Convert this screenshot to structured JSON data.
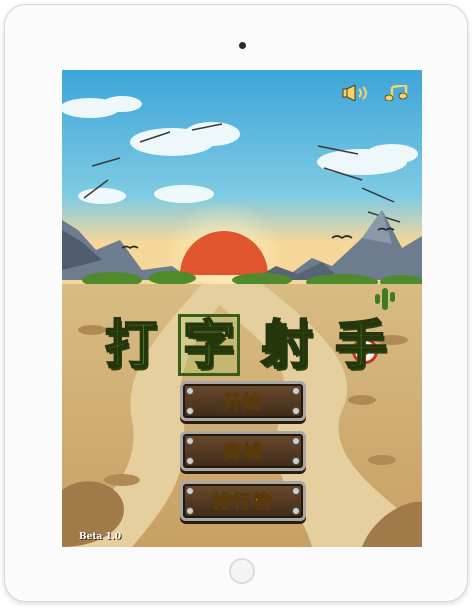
{
  "game": {
    "title_chars": [
      "打",
      "字",
      "射",
      "手"
    ],
    "menu": {
      "start_label": "开始",
      "shop_label": "商城",
      "leaderboard_label": "排行榜"
    },
    "version": "Beta 1.0",
    "icons": {
      "sound": "speaker-icon",
      "music": "music-note-icon"
    }
  },
  "colors": {
    "sky": "#58b4dc",
    "title_green": "#79a82a",
    "button_text": "#f2c230",
    "button_wood": "#5a3c22"
  }
}
